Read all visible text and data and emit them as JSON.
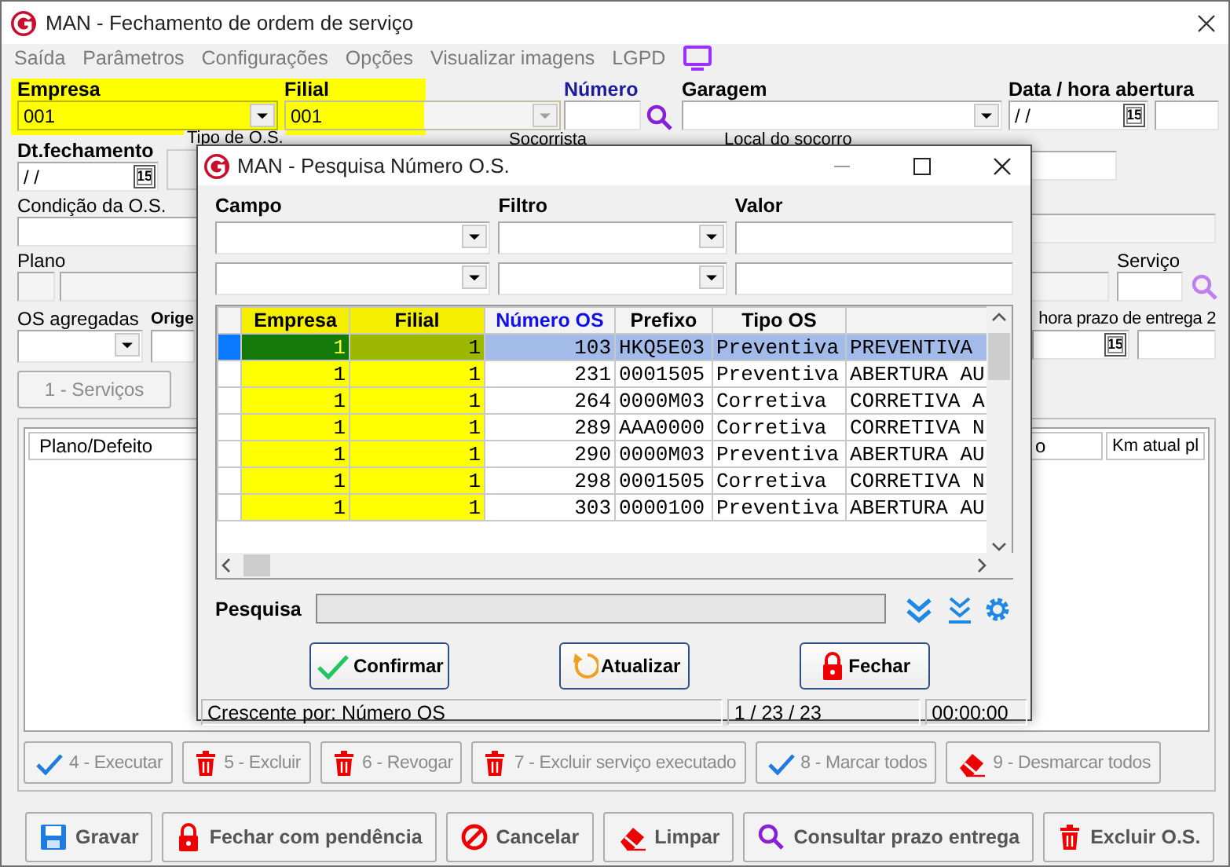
{
  "window": {
    "title": "MAN - Fechamento de ordem de serviço"
  },
  "menu": [
    {
      "label": "Saída"
    },
    {
      "label": "Parâmetros"
    },
    {
      "label": "Configurações"
    },
    {
      "label": "Opções"
    },
    {
      "label": "Visualizar imagens"
    },
    {
      "label": "LGPD"
    }
  ],
  "form": {
    "empresa": {
      "label": "Empresa",
      "value": "001"
    },
    "filial": {
      "label": "Filial",
      "value": "001"
    },
    "numero": {
      "label": "Número"
    },
    "garagem": {
      "label": "Garagem"
    },
    "data_abertura": {
      "label": "Data / hora abertura",
      "date": "/ /",
      "calendar": "15"
    },
    "dt_fechamento": {
      "label": "Dt.fechamento",
      "date": "/ /",
      "calendar": "15"
    },
    "tipo_os": {
      "label": "Tipo de O.S."
    },
    "socorrista": {
      "label": "Socorrista"
    },
    "local_socorro": {
      "label": "Local do socorro"
    },
    "condicao": {
      "label": "Condição da O.S."
    },
    "plano": {
      "label": "Plano"
    },
    "servico": {
      "label": "Serviço"
    },
    "os_agregadas": {
      "label": "OS agregadas"
    },
    "origem": {
      "label": "Orige"
    },
    "prazo_entrega_2": {
      "label": "hora prazo de entrega 2",
      "calendar": "15"
    },
    "tab_buttons": [
      {
        "label": "1 - Serviços",
        "disabled": true
      }
    ]
  },
  "services_grid": {
    "columns": [
      "Plano/Defeito",
      "o",
      "Km atual pl"
    ]
  },
  "service_actions": [
    {
      "label": "4 - Executar",
      "kind": "confirm",
      "disabled": true
    },
    {
      "label": "5 - Excluir",
      "kind": "delete",
      "disabled": true
    },
    {
      "label": "6 - Revogar",
      "kind": "delete",
      "disabled": true
    },
    {
      "label": "7 - Excluir serviço executado",
      "kind": "delete",
      "disabled": true
    },
    {
      "label": "8 - Marcar todos",
      "kind": "confirm",
      "disabled": true
    },
    {
      "label": "9 - Desmarcar todos",
      "kind": "erase",
      "disabled": true
    }
  ],
  "bottom_actions": [
    {
      "label": "Gravar",
      "kind": "save"
    },
    {
      "label": "Fechar com pendência",
      "kind": "lock"
    },
    {
      "label": "Cancelar",
      "kind": "cancel"
    },
    {
      "label": "Limpar",
      "kind": "erase"
    },
    {
      "label": "Consultar prazo entrega",
      "kind": "search"
    },
    {
      "label": "Excluir O.S.",
      "kind": "delete"
    }
  ],
  "dialog": {
    "title": "MAN - Pesquisa Número O.S.",
    "filter_labels": [
      "Campo",
      "Filtro",
      "Valor"
    ],
    "table": {
      "columns": [
        {
          "label": "Empresa",
          "highlighted": true,
          "sorted": false
        },
        {
          "label": "Filial",
          "highlighted": true,
          "sorted": false
        },
        {
          "label": "Número OS",
          "highlighted": false,
          "sorted": true
        },
        {
          "label": "Prefixo",
          "highlighted": false,
          "sorted": false
        },
        {
          "label": "Tipo OS",
          "highlighted": false,
          "sorted": false
        }
      ],
      "rows": [
        {
          "cells": [
            "1",
            "1",
            "103",
            "HKQ5E03",
            "Preventiva",
            "PREVENTIVA"
          ],
          "selected": true
        },
        {
          "cells": [
            "1",
            "1",
            "231",
            "0001505",
            "Preventiva",
            "ABERTURA AU"
          ],
          "selected": false
        },
        {
          "cells": [
            "1",
            "1",
            "264",
            "0000M03",
            "Corretiva",
            "CORRETIVA A"
          ],
          "selected": false
        },
        {
          "cells": [
            "1",
            "1",
            "289",
            "AAA0000",
            "Corretiva",
            "CORRETIVA N"
          ],
          "selected": false
        },
        {
          "cells": [
            "1",
            "1",
            "290",
            "0000M03",
            "Preventiva",
            "ABERTURA AU"
          ],
          "selected": false
        },
        {
          "cells": [
            "1",
            "1",
            "298",
            "0001505",
            "Corretiva",
            "CORRETIVA N"
          ],
          "selected": false
        },
        {
          "cells": [
            "1",
            "1",
            "303",
            "0000100",
            "Preventiva",
            "ABERTURA AU"
          ],
          "selected": false
        }
      ]
    },
    "search": {
      "label": "Pesquisa"
    },
    "buttons": [
      {
        "label": "Confirmar",
        "kind": "confirm"
      },
      {
        "label": "Atualizar",
        "kind": "refresh"
      },
      {
        "label": "Fechar",
        "kind": "lock"
      }
    ],
    "status_bar": [
      "Crescente por: Número OS",
      "1 / 23 / 23",
      "00:00:00"
    ]
  }
}
